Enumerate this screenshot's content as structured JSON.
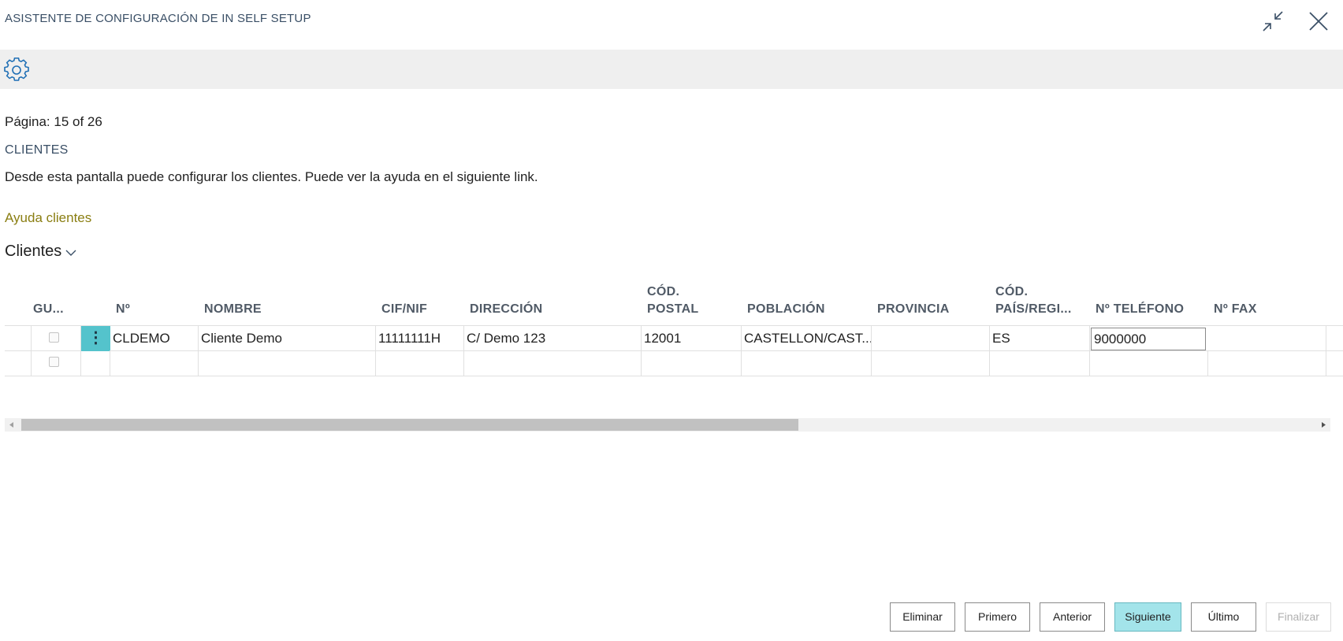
{
  "window": {
    "title": "ASISTENTE DE CONFIGURACIÓN DE IN SELF SETUP",
    "collapse_icon": "collapse-arrows-icon",
    "close_icon": "close-icon"
  },
  "action_bar": {
    "settings_icon": "gear-icon"
  },
  "page": {
    "page_info": "Página: 15 of 26",
    "section_title": "CLIENTES",
    "description": "Desde esta pantalla puede configurar los clientes. Puede ver la ayuda en el siguiente link.",
    "help_link": "Ayuda clientes",
    "group_label": "Clientes"
  },
  "grid": {
    "columns": {
      "gu": "GU...",
      "no": "Nº",
      "nombre": "NOMBRE",
      "cif": "CIF/NIF",
      "direccion": "DIRECCIÓN",
      "cp_line1": "CÓD.",
      "cp_line2": "POSTAL",
      "poblacion": "POBLACIÓN",
      "provincia": "PROVINCIA",
      "pais_line1": "CÓD.",
      "pais_line2": "PAÍS/REGI...",
      "telefono": "Nº TELÉFONO",
      "fax": "Nº FAX"
    },
    "rows": [
      {
        "no": "CLDEMO",
        "nombre": "Cliente Demo",
        "cif": "11111111H",
        "direccion": "C/ Demo 123",
        "cp": "12001",
        "poblacion": "CASTELLON/CAST...",
        "provincia": "",
        "pais": "ES",
        "telefono": "9000000",
        "fax": ""
      },
      {
        "no": "",
        "nombre": "",
        "cif": "",
        "direccion": "",
        "cp": "",
        "poblacion": "",
        "provincia": "",
        "pais": "",
        "telefono": "",
        "fax": ""
      }
    ],
    "row_menu_glyph": "⋮"
  },
  "scrollbar": {
    "left_icon": "scroll-left-icon",
    "right_icon": "scroll-right-icon"
  },
  "footer": {
    "eliminar": "Eliminar",
    "primero": "Primero",
    "anterior": "Anterior",
    "siguiente": "Siguiente",
    "ultimo": "Último",
    "finalizar": "Finalizar"
  },
  "colors": {
    "accent": "#54c3cc",
    "primary_button": "#a3e4ea",
    "link": "#8a7e12",
    "title": "#3a4f66"
  }
}
